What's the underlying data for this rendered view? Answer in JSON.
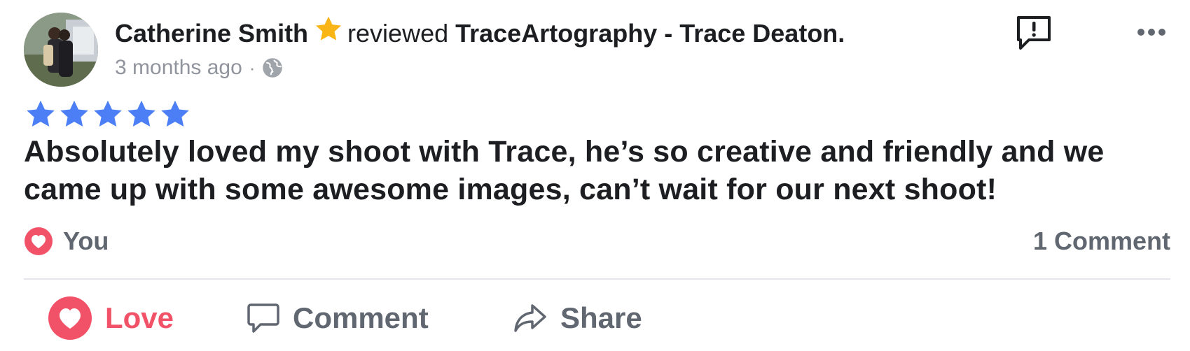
{
  "review": {
    "author": "Catherine Smith",
    "verb": "reviewed",
    "page_name": "TraceArtography - Trace Deaton.",
    "time": "3 months ago",
    "separator": "·",
    "privacy_icon": "globe-icon",
    "rating": 5,
    "rating_max": 5,
    "text": "Absolutely loved my shoot with Trace, he’s so creative and friendly and we came up with some awesome images, can’t wait for our next shoot!"
  },
  "reactions": {
    "label": "You",
    "comment_count": "1 Comment"
  },
  "actions": {
    "love": "Love",
    "comment": "Comment",
    "share": "Share"
  },
  "colors": {
    "star_rating": "#4c7ff5",
    "badge_star": "#f9b516",
    "love": "#f25268",
    "secondary_text": "#616770",
    "timestamp": "#90949c"
  }
}
